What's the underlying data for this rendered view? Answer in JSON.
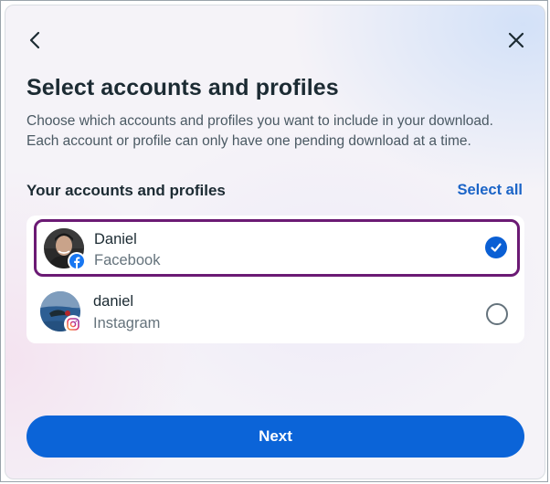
{
  "dialog": {
    "title": "Select accounts and profiles",
    "description": "Choose which accounts and profiles you want to include in your download. Each account or profile can only have one pending download at a time.",
    "back_icon": "chevron-left-icon",
    "close_icon": "close-icon"
  },
  "section": {
    "label": "Your accounts and profiles",
    "select_all_label": "Select all"
  },
  "accounts": [
    {
      "name": "Daniel",
      "platform": "Facebook",
      "selected": true,
      "badge_icon": "facebook-icon"
    },
    {
      "name": "daniel",
      "platform": "Instagram",
      "selected": false,
      "badge_icon": "instagram-icon"
    }
  ],
  "footer": {
    "next_label": "Next"
  },
  "colors": {
    "accent": "#0b64d8",
    "link": "#1b64c7",
    "selected_outline": "#6b1a74"
  }
}
